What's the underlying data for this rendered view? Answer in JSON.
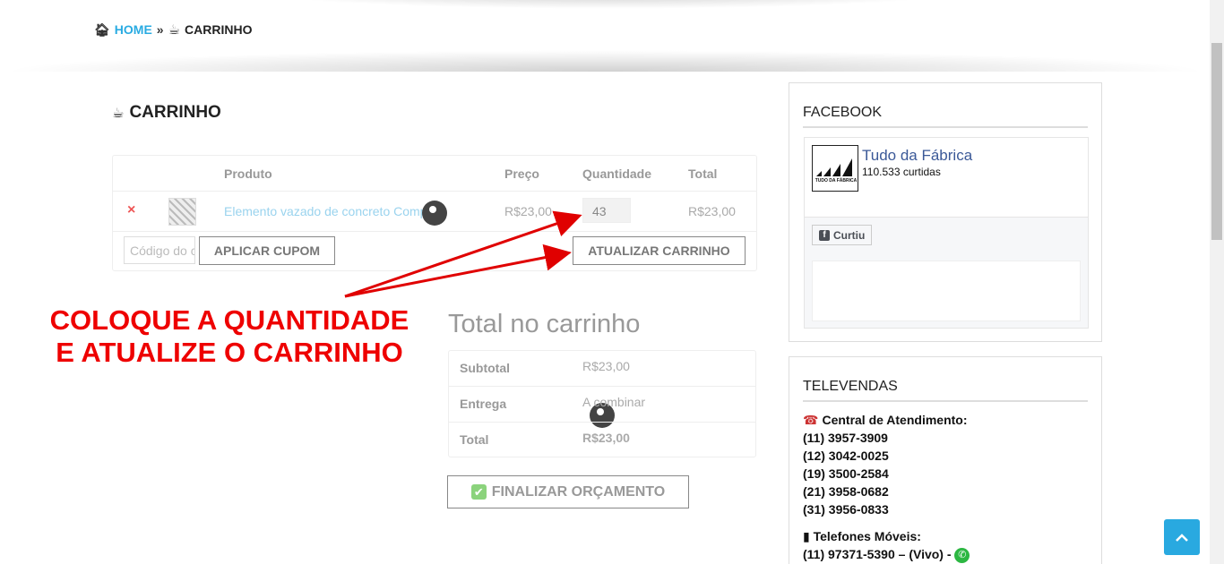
{
  "breadcrumb": {
    "home": "HOME",
    "separator": "»",
    "current": "CARRINHO",
    "home_icon": "home-icon",
    "cup_icon": "coffee-cup-icon"
  },
  "cart": {
    "title": "CARRINHO",
    "columns": {
      "product": "Produto",
      "price": "Preço",
      "quantity": "Quantidade",
      "total": "Total"
    },
    "item": {
      "remove": "×",
      "name": "Elemento vazado de concreto Compose",
      "price": "R$23,00",
      "quantity": "43",
      "total": "R$23,00"
    },
    "coupon_placeholder": "Código do cupom",
    "apply_coupon": "APLICAR CUPOM",
    "update_cart": "ATUALIZAR CARRINHO"
  },
  "annotation": {
    "line1": "COLOQUE A QUANTIDADE",
    "line2": "E ATUALIZE O CARRINHO",
    "color": "#e00000"
  },
  "totals": {
    "title": "Total no carrinho",
    "subtotal_label": "Subtotal",
    "subtotal": "R$23,00",
    "shipping_label": "Entrega",
    "shipping": "A combinar",
    "total_label": "Total",
    "total": "R$23,00",
    "finalize": "FINALIZAR ORÇAMENTO"
  },
  "facebook": {
    "title": "FACEBOOK",
    "page_name": "Tudo da Fábrica",
    "likes": "110.533 curtidas",
    "logo_text": "TUDO DA FÁBRICA",
    "liked_button": "Curtiu"
  },
  "televendas": {
    "title": "TELEVENDAS",
    "central_label": "Central de Atendimento:",
    "phones": [
      "(11) 3957-3909",
      "(12) 3042-0025",
      "(19) 3500-2584",
      "(21) 3958-0682",
      "(31) 3956-0833"
    ],
    "mobile_label": "Telefones Móveis:",
    "mobile": "(11) 97371-5390 – (Vivo) -"
  },
  "colors": {
    "accent": "#29abe2",
    "annotation": "#e00000",
    "facebook": "#3b5998"
  }
}
